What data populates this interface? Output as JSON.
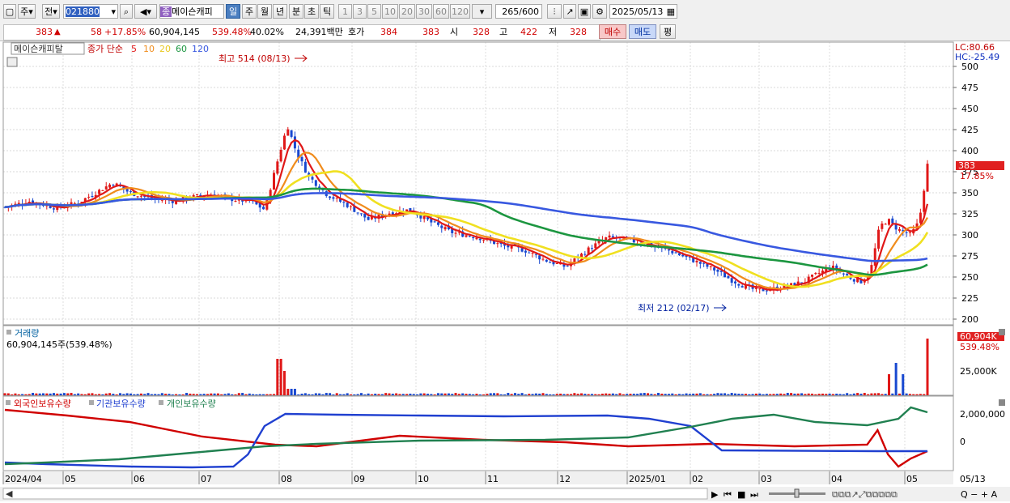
{
  "toolbar": {
    "period_unit": "주",
    "prev_label": "전",
    "code": "021880",
    "name_badge": "종",
    "name": "메이슨캐피",
    "periods": [
      "일",
      "주",
      "월",
      "년",
      "분",
      "초",
      "틱"
    ],
    "active_period": "일",
    "intervals": [
      "1",
      "3",
      "5",
      "10",
      "20",
      "30",
      "60",
      "120"
    ],
    "count": "265",
    "count_total": "/600",
    "date": "2025/05/13"
  },
  "quote": {
    "price": "383",
    "direction_arrow": "▲",
    "change": "58",
    "change_pct": "+17.85%",
    "volume": "60,904,145",
    "volume_pct": "539.48%",
    "turnover_pct": "40.02%",
    "amount": "24,391백만",
    "bid_label": "호가",
    "ask_price": "384",
    "bid_price": "383",
    "open_label": "시",
    "open": "328",
    "high_label": "고",
    "high": "422",
    "low_label": "저",
    "low": "328",
    "buy_label": "매수",
    "sell_label": "매도",
    "avg_label": "평"
  },
  "price_panel": {
    "stock_name": "메이슨캐피탈",
    "ma_title": "종가 단순",
    "ma_periods": [
      "5",
      "10",
      "20",
      "60",
      "120"
    ],
    "ma_colors": [
      "#e01818",
      "#f08c1c",
      "#f0e020",
      "#1c9640",
      "#3858e0"
    ],
    "high_note": "최고 514 (08/13)",
    "low_note": "최저 212 (02/17)",
    "lc": "LC:80.66",
    "hc": "HC:-25.49",
    "last_price": "383",
    "last_pct": "17.85%",
    "y_ticks": [
      "500",
      "475",
      "450",
      "425",
      "400",
      "375",
      "350",
      "325",
      "300",
      "275",
      "250",
      "225",
      "200"
    ]
  },
  "volume_panel": {
    "title": "거래량",
    "value_line": "60,904,145주(539.48%)",
    "last_label": "60,904K",
    "last_pct": "539.48%",
    "y_tick": "25,000K"
  },
  "holdings_panel": {
    "legend": [
      {
        "label": "외국인보유수량",
        "color": "#d00000"
      },
      {
        "label": "기관보유수량",
        "color": "#2040d0"
      },
      {
        "label": "개인보유수량",
        "color": "#208050"
      }
    ],
    "y_ticks": [
      "2,000,000",
      "0"
    ]
  },
  "x_axis": [
    "2024/04",
    "05",
    "06",
    "07",
    "08",
    "09",
    "10",
    "11",
    "12",
    "2025/01",
    "02",
    "03",
    "04",
    "05",
    "05/13"
  ]
}
